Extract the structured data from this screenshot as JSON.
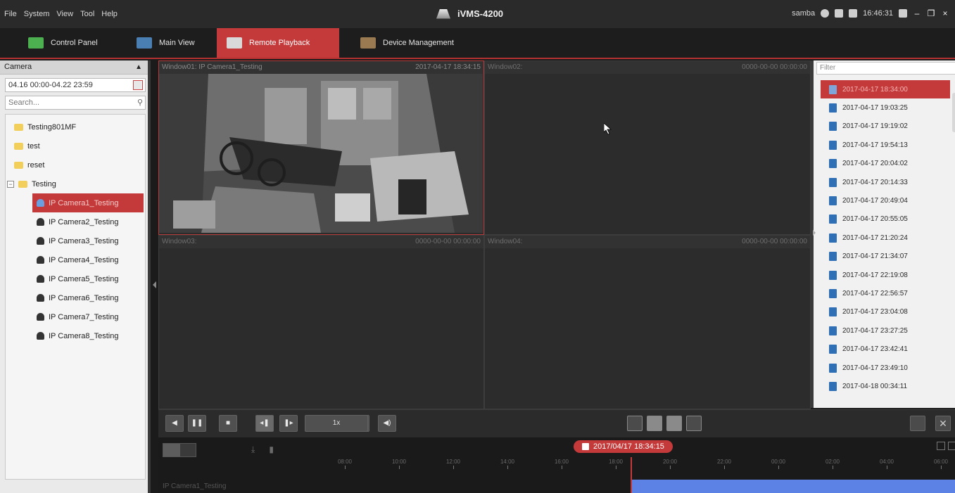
{
  "menu": [
    "File",
    "System",
    "View",
    "Tool",
    "Help"
  ],
  "app_title": "iVMS-4200",
  "status": {
    "user": "samba",
    "clock": "16:46:31"
  },
  "tabs": [
    {
      "label": "Control Panel",
      "color": "#4caf50"
    },
    {
      "label": "Main View",
      "color": "#4a7fb3"
    },
    {
      "label": "Remote Playback",
      "color": "#d9d9d9",
      "active": true
    },
    {
      "label": "Device Management",
      "color": "#9a7a50"
    }
  ],
  "camera_panel": {
    "header": "Camera",
    "date_range": "04.16 00:00-04.22 23:59",
    "search_placeholder": "Search...",
    "tree": [
      {
        "type": "folder",
        "label": "Testing801MF"
      },
      {
        "type": "folder",
        "label": "test"
      },
      {
        "type": "folder",
        "label": "reset"
      },
      {
        "type": "folder",
        "label": "Testing",
        "expanded": true,
        "expander": "−"
      },
      {
        "type": "cam",
        "label": "IP Camera1_Testing",
        "selected": true
      },
      {
        "type": "cam",
        "label": "IP Camera2_Testing"
      },
      {
        "type": "cam",
        "label": "IP Camera3_Testing"
      },
      {
        "type": "cam",
        "label": "IP Camera4_Testing"
      },
      {
        "type": "cam",
        "label": "IP Camera5_Testing"
      },
      {
        "type": "cam",
        "label": "IP Camera6_Testing"
      },
      {
        "type": "cam",
        "label": "IP Camera7_Testing"
      },
      {
        "type": "cam",
        "label": "IP Camera8_Testing"
      }
    ]
  },
  "windows": [
    {
      "title": "Window01: IP Camera1_Testing",
      "time": "2017-04-17 18:34:15",
      "active": true
    },
    {
      "title": "Window02:",
      "time": "0000-00-00 00:00:00"
    },
    {
      "title": "Window03:",
      "time": "0000-00-00 00:00:00"
    },
    {
      "title": "Window04:",
      "time": "0000-00-00 00:00:00"
    }
  ],
  "file_panel": {
    "filter_placeholder": "Filter",
    "files": [
      {
        "label": "2017-04-17 18:34:00",
        "selected": true
      },
      {
        "label": "2017-04-17 19:03:25"
      },
      {
        "label": "2017-04-17 19:19:02"
      },
      {
        "label": "2017-04-17 19:54:13"
      },
      {
        "label": "2017-04-17 20:04:02"
      },
      {
        "label": "2017-04-17 20:14:33"
      },
      {
        "label": "2017-04-17 20:49:04"
      },
      {
        "label": "2017-04-17 20:55:05"
      },
      {
        "label": "2017-04-17 21:20:24"
      },
      {
        "label": "2017-04-17 21:34:07"
      },
      {
        "label": "2017-04-17 22:19:08"
      },
      {
        "label": "2017-04-17 22:56:57"
      },
      {
        "label": "2017-04-17 23:04:08"
      },
      {
        "label": "2017-04-17 23:27:25"
      },
      {
        "label": "2017-04-17 23:42:41"
      },
      {
        "label": "2017-04-17 23:49:10"
      },
      {
        "label": "2017-04-18 00:34:11"
      }
    ]
  },
  "controls": {
    "buttons": [
      {
        "name": "reverse-play-button",
        "glyph": "◀"
      },
      {
        "name": "pause-button",
        "glyph": "❚❚"
      },
      {
        "name": "stop-button",
        "glyph": "■"
      },
      {
        "name": "single-frame-back-button",
        "glyph": "◂❚",
        "active": true
      },
      {
        "name": "single-frame-forward-button",
        "glyph": "❚▸"
      },
      {
        "name": "slow-button",
        "glyph": "◀◀"
      },
      {
        "name": "fast-button",
        "glyph": "▶▶"
      },
      {
        "name": "volume-button",
        "glyph": "◀)"
      }
    ],
    "speed": "1x"
  },
  "timeline": {
    "current_time": "2017/04/17 18:34:15",
    "track_label": "IP Camera1_Testing",
    "ticks": [
      "08:00",
      "10:00",
      "12:00",
      "14:00",
      "16:00",
      "18:00",
      "20:00",
      "22:00",
      "00:00",
      "02:00",
      "04:00",
      "06:00"
    ]
  }
}
